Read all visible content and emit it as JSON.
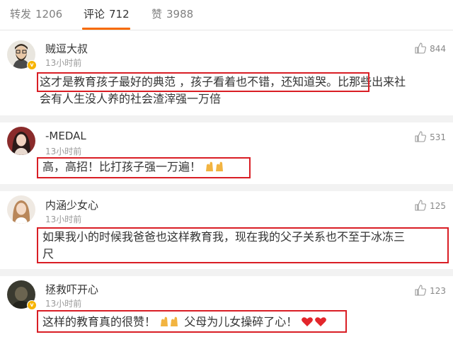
{
  "tabs": [
    {
      "label": "转发",
      "count": "1206"
    },
    {
      "label": "评论",
      "count": "712"
    },
    {
      "label": "赞",
      "count": "3988"
    }
  ],
  "comments": [
    {
      "user": "贼逗大叔",
      "time": "13小时前",
      "likes": "844",
      "highlighted": "这才是教育孩子最好的典范 ，孩子看着也不错，还知道哭。",
      "rest_line1": "比那些出来社",
      "rest_line2": "会有人生没人养的社会渣滓强一万倍"
    },
    {
      "user": "-MEDAL",
      "time": "13小时前",
      "likes": "531",
      "text": "高，高招！比打孩子强一万遍！"
    },
    {
      "user": "内涵少女心",
      "time": "13小时前",
      "likes": "125",
      "line1": "如果我小的时候我爸爸也这样教育我，现在我的父子关系也不至于冰冻三",
      "line2": "尺"
    },
    {
      "user": "拯救吓开心",
      "time": "13小时前",
      "likes": "123",
      "text_a": "这样的教育真的很赞！",
      "text_b": "父母为儿女操碎了心！"
    }
  ],
  "colors": {
    "accent_orange": "#f76a00",
    "highlight_red": "#d91e25",
    "verified_gold": "#f7b400"
  },
  "icons": [
    "thumbs-up-icon",
    "verified-badge-icon",
    "clap-emoji-icon",
    "heart-emoji-icon"
  ]
}
